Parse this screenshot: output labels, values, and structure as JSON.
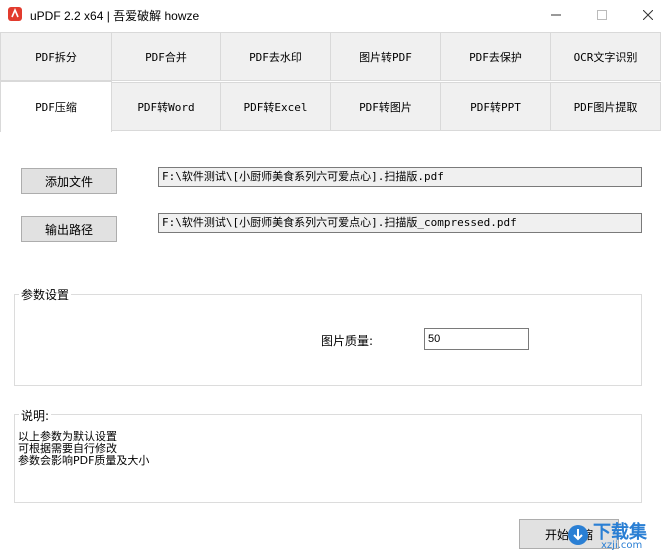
{
  "window": {
    "title": "uPDF 2.2 x64 | 吾爱破解 howze"
  },
  "tabs_row1": [
    "PDF拆分",
    "PDF合并",
    "PDF去水印",
    "图片转PDF",
    "PDF去保护",
    "OCR文字识别"
  ],
  "tabs_row2": [
    "PDF压缩",
    "PDF转Word",
    "PDF转Excel",
    "PDF转图片",
    "PDF转PPT",
    "PDF图片提取"
  ],
  "active_tab": "PDF压缩",
  "main": {
    "add_file_label": "添加文件",
    "add_file_path": "F:\\软件测试\\[小厨师美食系列六可爱点心].扫描版.pdf",
    "output_label": "输出路径",
    "output_path": "F:\\软件测试\\[小厨师美食系列六可爱点心].扫描版_compressed.pdf",
    "params_group_label": "参数设置",
    "quality_label": "图片质量:",
    "quality_value": "50",
    "notes_label": "说明:",
    "notes_lines": [
      "以上参数为默认设置",
      "可根据需要自行修改",
      "参数会影响PDF质量及大小"
    ],
    "start_button": "开始压缩"
  },
  "watermark": {
    "text": "下载集",
    "subtext": "xzji.com"
  }
}
